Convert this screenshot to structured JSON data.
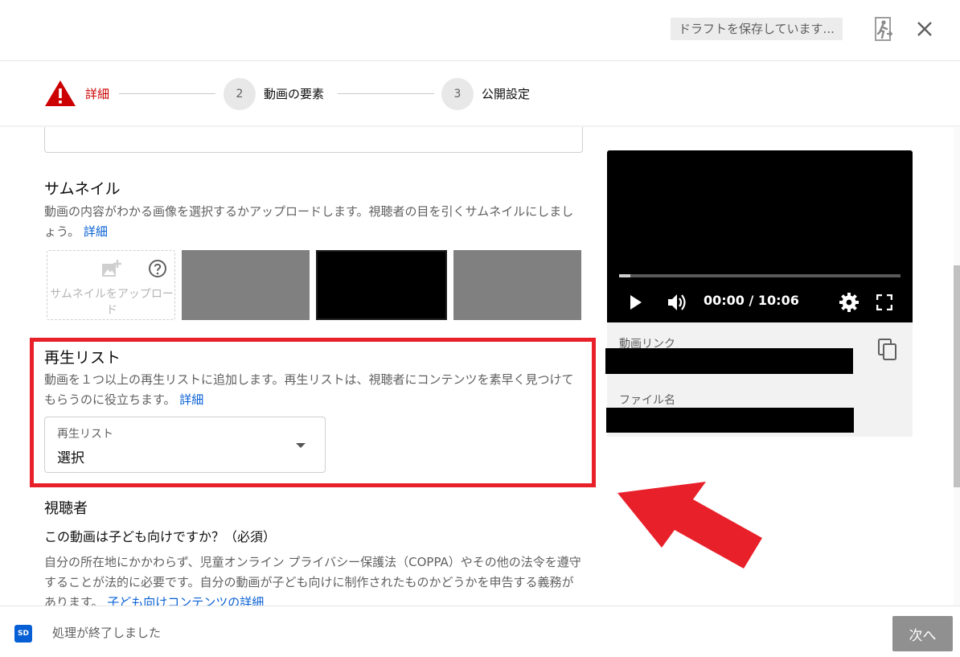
{
  "header": {
    "draft_status": "ドラフトを保存しています...",
    "icons": [
      "exit-icon",
      "close-icon"
    ]
  },
  "stepper": {
    "steps": [
      {
        "number": "",
        "label": "詳細",
        "state": "error"
      },
      {
        "number": "2",
        "label": "動画の要素",
        "state": "pending"
      },
      {
        "number": "3",
        "label": "公開設定",
        "state": "pending"
      }
    ],
    "error_color": "#cc0000"
  },
  "thumbnail": {
    "title": "サムネイル",
    "description": "動画の内容がわかる画像を選択するかアップロードします。視聴者の目を引くサムネイルにしましょう。",
    "link": "詳細",
    "upload_label": "サムネイルをアップロード",
    "options": [
      "thumbnail-1",
      "thumbnail-2",
      "thumbnail-3"
    ]
  },
  "playlist": {
    "title": "再生リスト",
    "description": "動画を１つ以上の再生リストに追加します。再生リストは、視聴者にコンテンツを素早く見つけてもらうのに役立ちます。",
    "link": "詳細",
    "select_label": "再生リスト",
    "select_value": "選択",
    "highlight_color": "#e8202a"
  },
  "audience": {
    "title": "視聴者",
    "question": "この動画は子ども向けですか？（必須）",
    "description": "自分の所在地にかかわらず、児童オンライン プライバシー保護法（COPPA）やその他の法令を遵守することが法的に必要です。自分の動画が子ども向けに制作されたものかどうかを申告する義務があります。",
    "link": "子ども向けコンテンツの詳細"
  },
  "video": {
    "time": "00:00 / 10:06",
    "progress": 0.04,
    "link_label": "動画リンク",
    "filename_label": "ファイル名",
    "icons": [
      "play-icon",
      "volume-icon",
      "settings-icon",
      "fullscreen-icon",
      "copy-icon"
    ]
  },
  "footer": {
    "badge": "SD",
    "status": "処理が終了しました",
    "next_label": "次へ"
  }
}
